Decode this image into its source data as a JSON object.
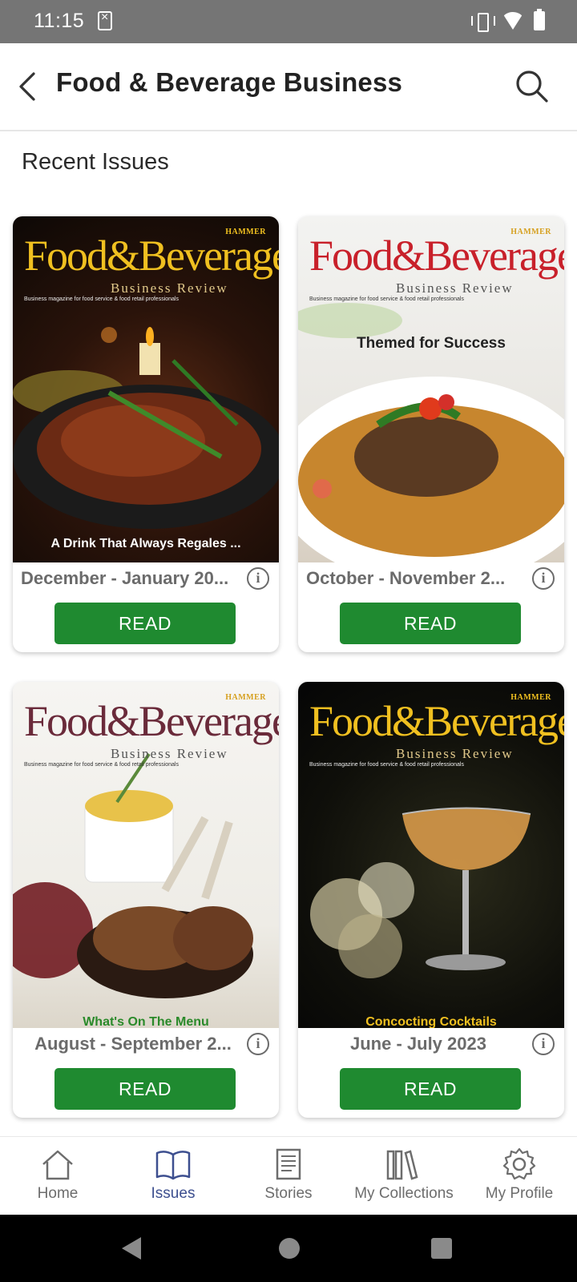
{
  "status_bar": {
    "time": "11:15"
  },
  "header": {
    "title": "Food & Beverage Business"
  },
  "section": {
    "title": "Recent Issues"
  },
  "issues": [
    {
      "title": "December - January 20...",
      "read_label": "READ",
      "cover": {
        "masthead": "Food&Beverage",
        "subtitle": "Business Review",
        "publisher": "HAMMER",
        "tagline": "Business magazine for food service & food retail professionals",
        "headline": "A Drink That Always Regales ..."
      }
    },
    {
      "title": "October - November 2...",
      "read_label": "READ",
      "cover": {
        "masthead": "Food&Beverage",
        "subtitle": "Business Review",
        "publisher": "HAMMER",
        "tagline": "Business magazine for food service & food retail professionals",
        "headline": "Themed for Success"
      }
    },
    {
      "title": "August - September 2...",
      "read_label": "READ",
      "cover": {
        "masthead": "Food&Beverage",
        "subtitle": "Business Review",
        "publisher": "HAMMER",
        "tagline": "Business magazine for food service & food retail professionals",
        "headline": "What's On The Menu"
      }
    },
    {
      "title": "June - July 2023",
      "read_label": "READ",
      "cover": {
        "masthead": "Food&Beverage",
        "subtitle": "Business Review",
        "publisher": "HAMMER",
        "tagline": "Business magazine for food service & food retail professionals",
        "headline": "Concocting Cocktails"
      }
    }
  ],
  "bottom_nav": {
    "items": [
      {
        "label": "Home",
        "icon": "home-icon"
      },
      {
        "label": "Issues",
        "icon": "book-open-icon",
        "active": true
      },
      {
        "label": "Stories",
        "icon": "document-icon"
      },
      {
        "label": "My Collections",
        "icon": "library-icon"
      },
      {
        "label": "My Profile",
        "icon": "gear-icon"
      }
    ]
  },
  "colors": {
    "accent_green": "#1f8a30",
    "active_nav": "#3d4f8f",
    "status_bar": "#757575"
  }
}
